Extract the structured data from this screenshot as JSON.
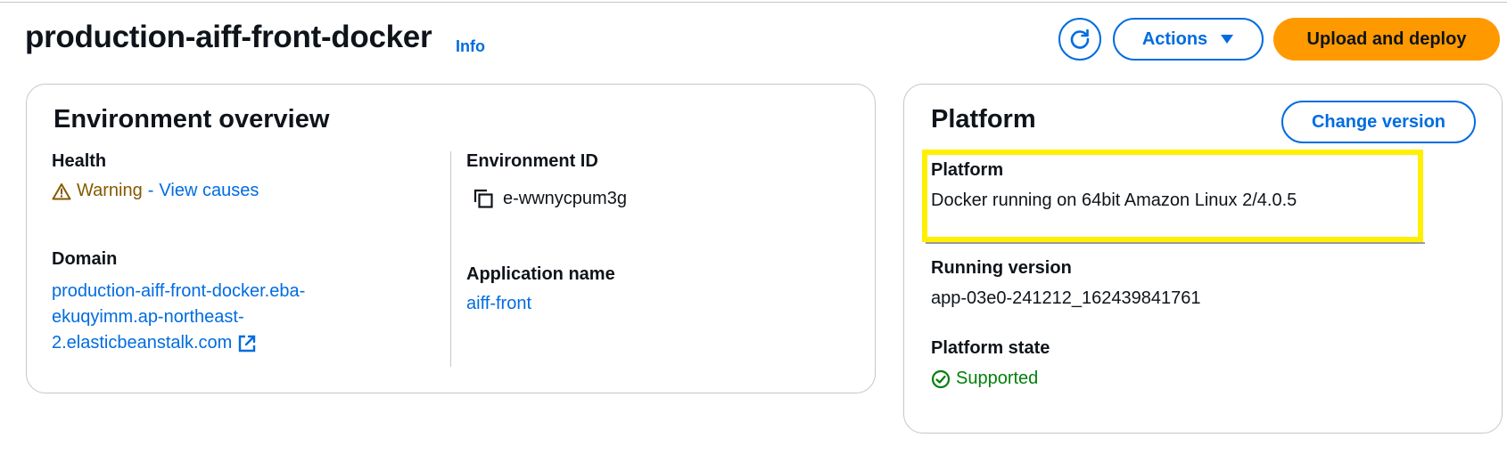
{
  "header": {
    "title": "production-aiff-front-docker",
    "info_label": "Info",
    "actions_label": "Actions",
    "upload_label": "Upload and deploy"
  },
  "environment_overview": {
    "title": "Environment overview",
    "health_label": "Health",
    "health_status": "Warning",
    "health_separator": "-",
    "health_link": "View causes",
    "domain_label": "Domain",
    "domain_lines": [
      "production-aiff-front-docker.eba-",
      "ekuqyimm.ap-northeast-",
      "2.elasticbeanstalk.com"
    ],
    "environment_id_label": "Environment ID",
    "environment_id": "e-wwnycpum3g",
    "application_name_label": "Application name",
    "application_name": "aiff-front"
  },
  "platform": {
    "title": "Platform",
    "change_version_label": "Change version",
    "platform_label": "Platform",
    "platform_value": "Docker running on 64bit Amazon Linux 2/4.0.5",
    "running_version_label": "Running version",
    "running_version": "app-03e0-241212_162439841761",
    "platform_state_label": "Platform state",
    "platform_state": "Supported"
  },
  "colors": {
    "link": "#006ce0",
    "warning": "#855900",
    "success": "#037f0c",
    "primary_button": "#ff9900",
    "highlight": "#ffef00"
  },
  "icons": [
    "refresh-icon",
    "caret-down-icon",
    "warning-icon",
    "copy-icon",
    "external-link-icon",
    "check-circle-icon"
  ]
}
